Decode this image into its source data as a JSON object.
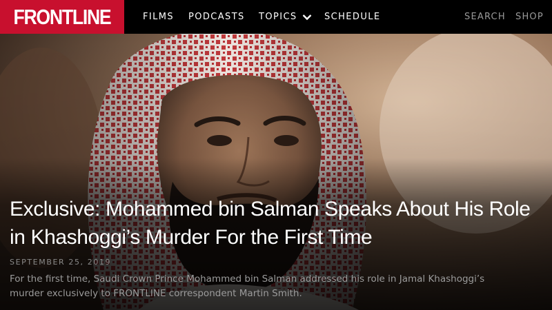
{
  "nav": {
    "logo_text": "FRONTLINE",
    "items": [
      {
        "label": "FILMS"
      },
      {
        "label": "PODCASTS"
      },
      {
        "label": "TOPICS"
      },
      {
        "label": "SCHEDULE"
      }
    ],
    "search_label": "SEARCH",
    "shop_label": "SHOP",
    "topics_icon": "chevron-down-icon"
  },
  "colors": {
    "brand_red": "#c8102e",
    "nav_bg": "#000000",
    "muted_text": "#9a9a9a"
  },
  "hero": {
    "image_subject": "portrait-photo",
    "headline": "Exclusive: Mohammed bin Salman Speaks About His Role in Khashoggi’s Murder For the First Time",
    "date": "SEPTEMBER 25, 2019",
    "summary": "For the first time, Saudi Crown Prince Mohammed bin Salman addressed his role in Jamal Khashoggi’s murder exclusively to FRONTLINE correspondent Martin Smith."
  }
}
